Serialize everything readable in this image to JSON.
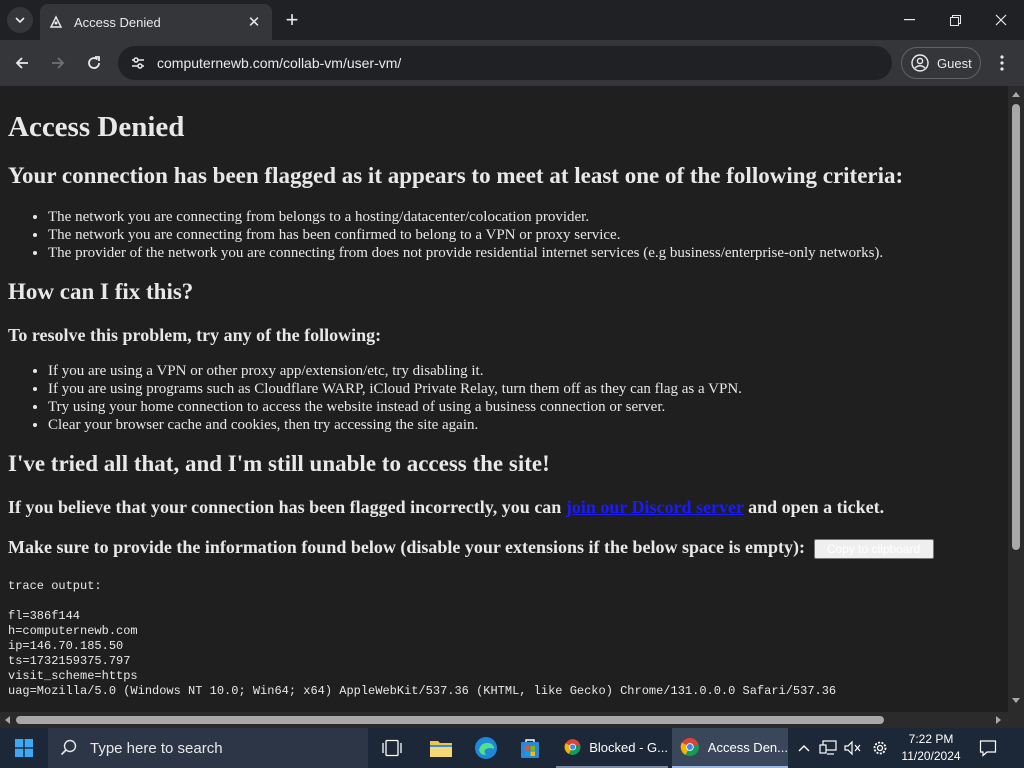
{
  "browser": {
    "tab": {
      "title": "Access Denied"
    },
    "new_tab_label": "+",
    "url": "computernewb.com/collab-vm/user-vm/",
    "profile_label": "Guest"
  },
  "page": {
    "title": "Access Denied",
    "flagged_heading": "Your connection has been flagged as it appears to meet at least one of the following criteria:",
    "criteria": [
      "The network you are connecting from belongs to a hosting/datacenter/colocation provider.",
      "The network you are connecting from has been confirmed to belong to a VPN or proxy service.",
      "The provider of the network you are connecting from does not provide residential internet services (e.g business/enterprise-only networks)."
    ],
    "fix_heading": "How can I fix this?",
    "resolve_heading": "To resolve this problem, try any of the following:",
    "fixes": [
      "If you are using a VPN or other proxy app/extension/etc, try disabling it.",
      "If you are using programs such as Cloudflare WARP, iCloud Private Relay, turn them off as they can flag as a VPN.",
      "Try using your home connection to access the website instead of using a business connection or server.",
      "Clear your browser cache and cookies, then try accessing the site again."
    ],
    "tried_heading": "I've tried all that, and I'm still unable to access the site!",
    "ticket_prefix": "If you believe that your connection has been flagged incorrectly, you can",
    "ticket_link": "join our Discord server",
    "ticket_suffix": "and open a ticket.",
    "provide_info": "Make sure to provide the information found below (disable your extensions if the below space is empty):",
    "copy_button": "Copy to clipboard",
    "trace": "trace output:\n\nfl=386f144\nh=computernewb.com\nip=146.70.185.50\nts=1732159375.797\nvisit_scheme=https\nuag=Mozilla/5.0 (Windows NT 10.0; Win64; x64) AppleWebKit/537.36 (KHTML, like Gecko) Chrome/131.0.0.0 Safari/537.36"
  },
  "taskbar": {
    "search_placeholder": "Type here to search",
    "apps": [
      {
        "label": "Blocked - G..."
      },
      {
        "label": "Access Den..."
      }
    ],
    "clock": {
      "time": "7:22 PM",
      "date": "11/20/2024"
    }
  },
  "colors": {
    "page_bg": "#1f1f1f",
    "link": "#1a1aff",
    "taskbar_bg": "#1c2738"
  },
  "icons": [
    "tab-search-icon",
    "favicon-icon",
    "close-icon",
    "plus-icon",
    "minimize-icon",
    "maximize-icon",
    "back-icon",
    "forward-icon",
    "reload-icon",
    "site-info-icon",
    "profile-icon",
    "menu-icon",
    "windows-logo-icon",
    "search-icon",
    "task-view-icon",
    "file-explorer-icon",
    "edge-icon",
    "store-icon",
    "chrome-icon",
    "chevron-up-icon",
    "network-icon",
    "volume-icon",
    "settings-icon",
    "notification-icon"
  ]
}
